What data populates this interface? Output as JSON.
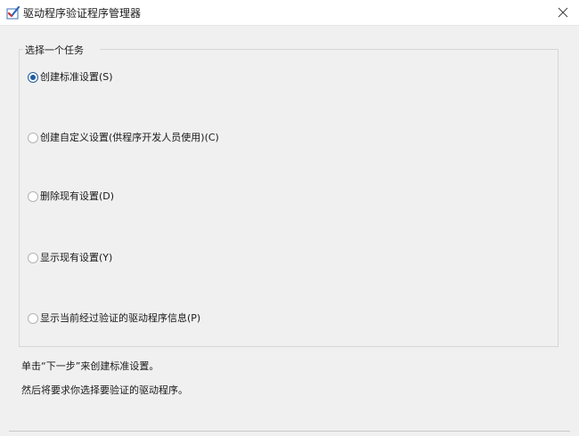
{
  "window": {
    "title": "驱动程序验证程序管理器",
    "icon": "driver-verifier-check-icon",
    "close_icon": "close-icon"
  },
  "group": {
    "legend": "选择一个任务"
  },
  "options": [
    {
      "label": "创建标准设置(S)",
      "checked": true
    },
    {
      "label": "创建自定义设置(供程序开发人员使用)(C)",
      "checked": false
    },
    {
      "label": "删除现有设置(D)",
      "checked": false
    },
    {
      "label": "显示现有设置(Y)",
      "checked": false
    },
    {
      "label": "显示当前经过验证的驱动程序信息(P)",
      "checked": false
    }
  ],
  "info": {
    "line1": "单击“下一步”来创建标准设置。",
    "line2": "然后将要求你选择要验证的驱动程序。"
  },
  "colors": {
    "accent": "#1f5c9e",
    "background": "#f0f0f0",
    "titlebar": "#ffffff"
  }
}
